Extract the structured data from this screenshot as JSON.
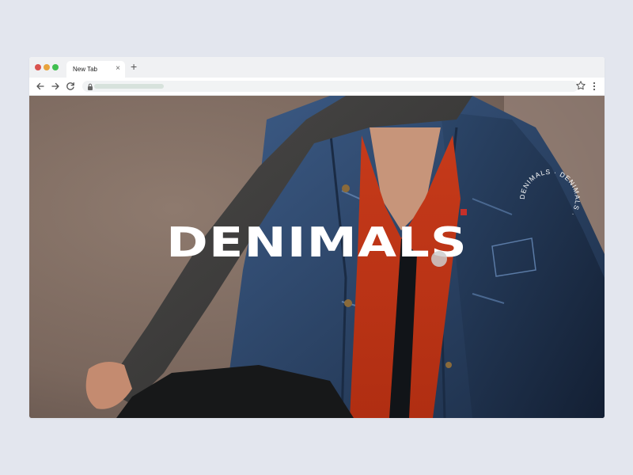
{
  "browser": {
    "tab": {
      "title": "New Tab",
      "close_symbol": "×"
    },
    "new_tab_symbol": "+",
    "icons": {
      "back": "arrow-left-icon",
      "forward": "arrow-right-icon",
      "reload": "reload-icon",
      "lock": "lock-icon",
      "bookmark": "star-icon",
      "menu": "kebab-menu-icon"
    },
    "colors": {
      "close": "#d9534f",
      "minimize": "#e8a33d",
      "maximize": "#3fbf4f"
    }
  },
  "page": {
    "title": "DENIMALS",
    "badge_text": "DENIMALS · DENIMALS · ",
    "colors": {
      "title": "#ffffff",
      "badge": "#ffffff"
    }
  }
}
